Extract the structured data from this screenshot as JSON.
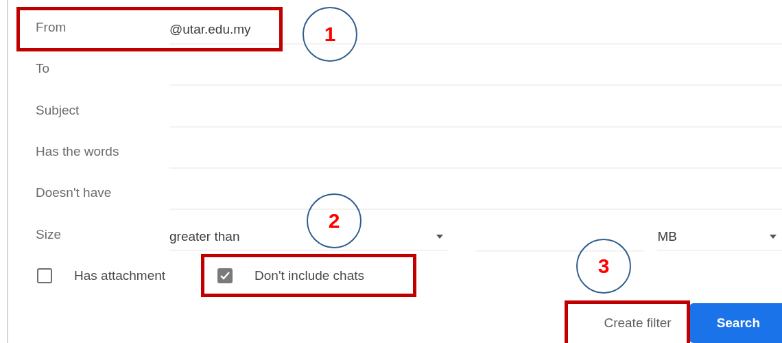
{
  "fields": [
    {
      "label": "From",
      "value": "@utar.edu.my"
    },
    {
      "label": "To"
    },
    {
      "label": "Subject"
    },
    {
      "label": "Has the words"
    },
    {
      "label": "Doesn't have"
    }
  ],
  "size": {
    "label": "Size",
    "comparison": "greater than",
    "unit": "MB"
  },
  "checkboxes": [
    {
      "label": "Has attachment",
      "checked": false
    },
    {
      "label": "Don't include chats",
      "checked": true
    }
  ],
  "buttons": [
    {
      "label": "Create filter",
      "kind": "text"
    },
    {
      "label": "Search",
      "kind": "primary"
    }
  ],
  "callouts": [
    {
      "number": "1"
    },
    {
      "number": "2"
    },
    {
      "number": "3"
    }
  ]
}
